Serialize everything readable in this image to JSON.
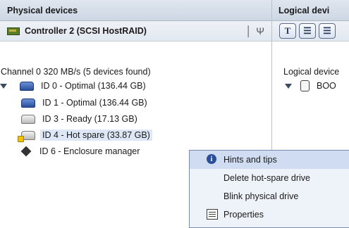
{
  "physical": {
    "header": "Physical devices",
    "controller": "Controller 2 (SCSI HostRAID)",
    "channel": "Channel 0  320 MB/s (5 devices found)",
    "devices": [
      {
        "label": "ID 0 - Optimal (136.44 GB)",
        "icon": "optimal-disk-icon"
      },
      {
        "label": "ID 1 - Optimal (136.44 GB)",
        "icon": "optimal-disk-icon"
      },
      {
        "label": "ID 3 - Ready (17.13 GB)",
        "icon": "ready-disk-icon"
      },
      {
        "label": "ID 4 - Hot spare (33.87 GB)",
        "icon": "hot-spare-disk-icon"
      },
      {
        "label": "ID 6 - Enclosure manager",
        "icon": "enclosure-icon"
      }
    ]
  },
  "logical": {
    "header": "Logical devi",
    "toolbar": [
      "T",
      "☰",
      "☰"
    ],
    "item_label": "Logical device",
    "item": "BOO"
  },
  "context_menu": {
    "items": [
      {
        "label": "Hints and tips",
        "icon": "info-icon"
      },
      {
        "label": "Delete hot-spare drive",
        "icon": ""
      },
      {
        "label": "Blink physical drive",
        "icon": ""
      },
      {
        "label": "Properties",
        "icon": "properties-icon"
      }
    ]
  }
}
